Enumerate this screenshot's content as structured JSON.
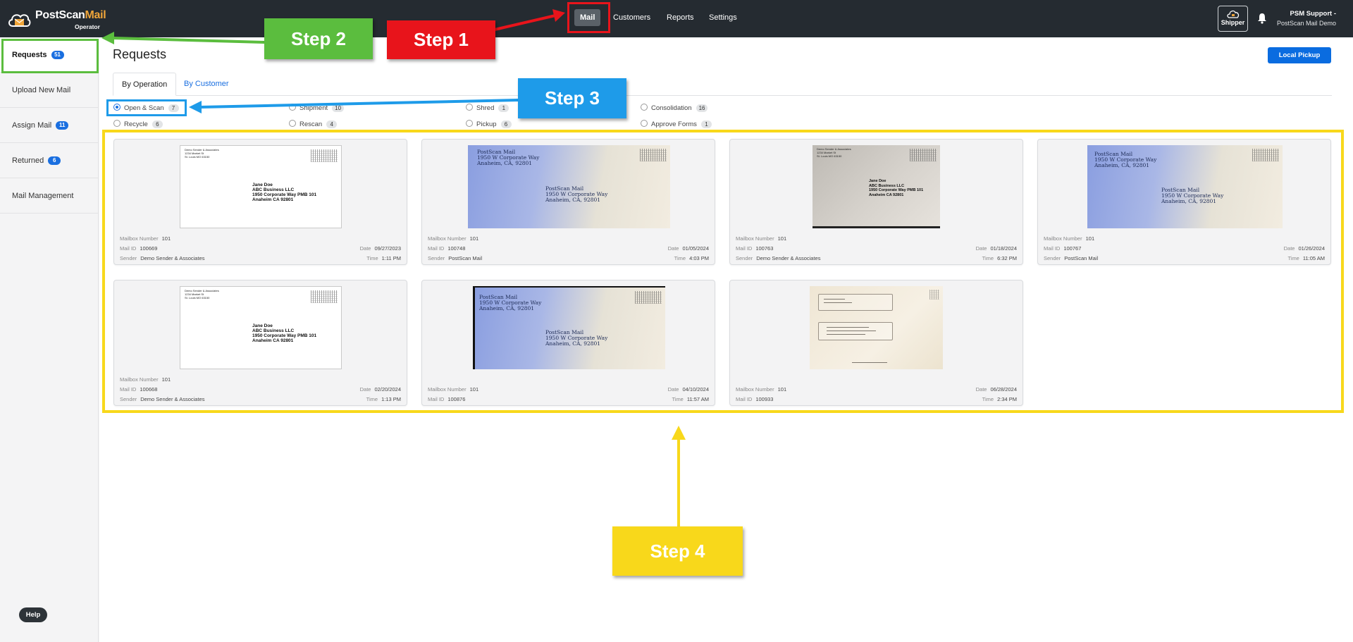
{
  "app": {
    "brand_part1": "PostScan",
    "brand_part2": "Mail",
    "brand_sub": "Operator"
  },
  "nav": {
    "items": [
      {
        "label": "Mail",
        "active": true
      },
      {
        "label": "Customers"
      },
      {
        "label": "Reports"
      },
      {
        "label": "Settings"
      }
    ],
    "shipper_label": "Shipper",
    "user_name": "PSM Support -",
    "user_org": "PostScan Mail Demo"
  },
  "sidebar": {
    "items": [
      {
        "label": "Requests",
        "badge": "51",
        "active": true
      },
      {
        "label": "Upload New Mail"
      },
      {
        "label": "Assign Mail",
        "badge": "11"
      },
      {
        "label": "Returned",
        "badge": "6"
      },
      {
        "label": "Mail Management"
      }
    ],
    "help_label": "Help"
  },
  "main": {
    "title": "Requests",
    "local_pickup_label": "Local Pickup",
    "tabs": [
      {
        "label": "By Operation",
        "active": true
      },
      {
        "label": "By Customer"
      }
    ],
    "filters": [
      {
        "label": "Open & Scan",
        "count": "7",
        "selected": true
      },
      {
        "label": "Shipment",
        "count": "10"
      },
      {
        "label": "Shred",
        "count": "1"
      },
      {
        "label": "Consolidation",
        "count": "16"
      },
      {
        "label": "Recycle",
        "count": "6"
      },
      {
        "label": "Rescan",
        "count": "4"
      },
      {
        "label": "Pickup",
        "count": "6"
      },
      {
        "label": "Approve Forms",
        "count": "1"
      }
    ]
  },
  "mail_labels": {
    "mailbox": "Mailbox Number",
    "mail_id": "Mail ID",
    "sender": "Sender",
    "date": "Date",
    "time": "Time"
  },
  "envelope_text": {
    "from_lines": [
      "Demo Sender & Associates",
      "1234 Market St",
      "St. Louis MO 63150"
    ],
    "to_lines": [
      "Jane Doe",
      "ABC Business LLC",
      "1950 Corporate Way PMB 101",
      "Anaheim CA 92801"
    ],
    "psm_lines": [
      "PostScan Mail",
      "1950 W Corporate Way",
      "Anaheim, CA, 92801"
    ]
  },
  "cards": [
    {
      "mailbox": "101",
      "mail_id": "100669",
      "sender": "Demo Sender & Associates",
      "date": "09/27/2023",
      "time": "1:11 PM",
      "style": "white"
    },
    {
      "mailbox": "101",
      "mail_id": "100748",
      "sender": "PostScan Mail",
      "date": "01/05/2024",
      "time": "4:03 PM",
      "style": "blue"
    },
    {
      "mailbox": "101",
      "mail_id": "100763",
      "sender": "Demo Sender & Associates",
      "date": "01/18/2024",
      "time": "6:32 PM",
      "style": "grey"
    },
    {
      "mailbox": "101",
      "mail_id": "100767",
      "sender": "PostScan Mail",
      "date": "01/26/2024",
      "time": "11:05 AM",
      "style": "blue"
    },
    {
      "mailbox": "101",
      "mail_id": "100668",
      "sender": "Demo Sender & Associates",
      "date": "02/20/2024",
      "time": "1:13 PM",
      "style": "white"
    },
    {
      "mailbox": "101",
      "mail_id": "100876",
      "sender": "",
      "date": "04/10/2024",
      "time": "11:57 AM",
      "style": "blue"
    },
    {
      "mailbox": "101",
      "mail_id": "100933",
      "sender": "",
      "date": "06/28/2024",
      "time": "2:34 PM",
      "style": "beige"
    }
  ],
  "annotations": [
    {
      "label": "Step 1",
      "color": "#e8141b"
    },
    {
      "label": "Step 2",
      "color": "#5bbd3e"
    },
    {
      "label": "Step 3",
      "color": "#1e9be9"
    },
    {
      "label": "Step 4",
      "color": "#f8d81b"
    }
  ]
}
